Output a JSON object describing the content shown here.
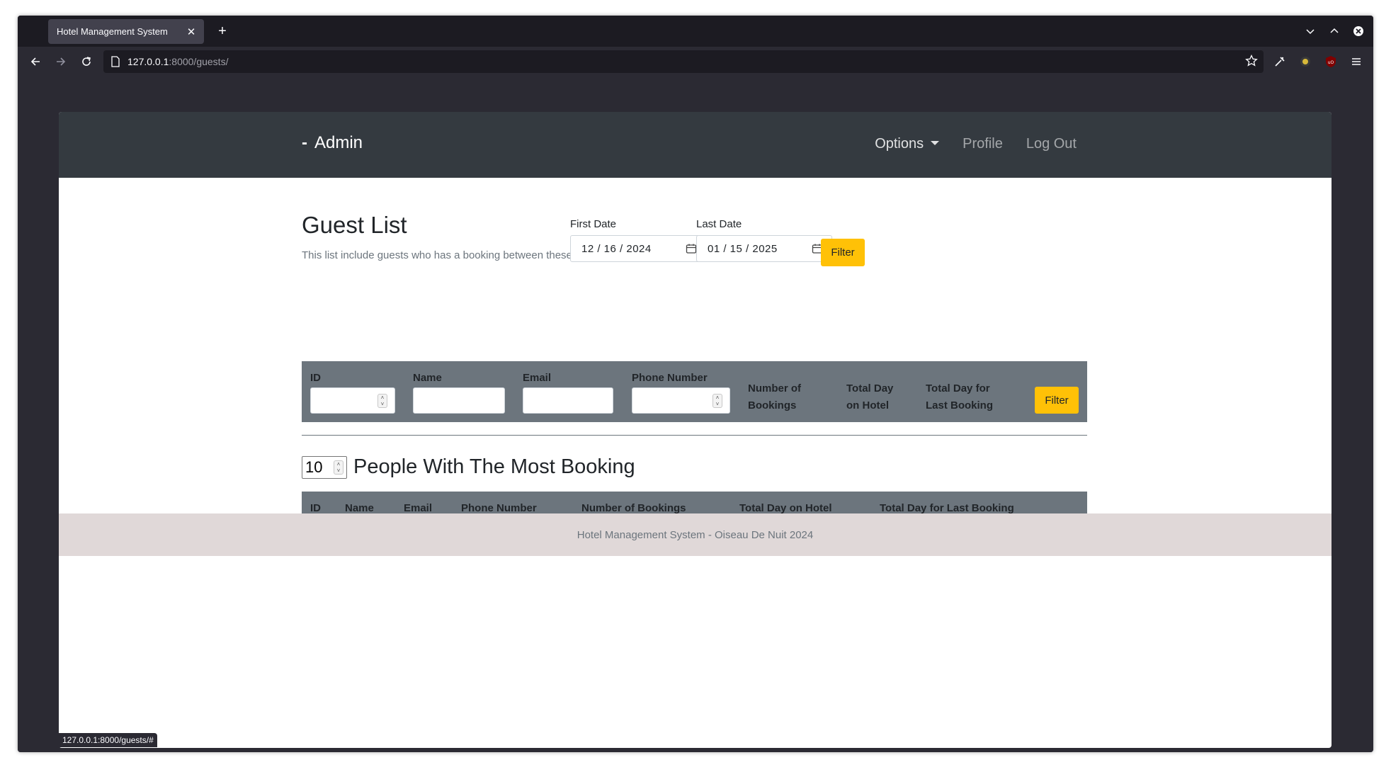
{
  "browser": {
    "tab_title": "Hotel Management System",
    "url_host": "127.0.0.1",
    "url_path": ":8000/guests/",
    "status_url": "127.0.0.1:8000/guests/#"
  },
  "header": {
    "brand_dash": "-",
    "brand": "Admin",
    "nav": {
      "options": "Options",
      "profile": "Profile",
      "logout": "Log Out"
    }
  },
  "guest_list": {
    "title": "Guest List",
    "subtitle": "This list include guests who has a booking between these days",
    "first_date_label": "First Date",
    "first_date_value": "12 / 16 / 2024",
    "last_date_label": "Last Date",
    "last_date_value": "01 / 15 / 2025",
    "filter_label": "Filter"
  },
  "filter_table": {
    "id": "ID",
    "name": "Name",
    "email": "Email",
    "phone": "Phone Number",
    "bookings_l1": "Number of",
    "bookings_l2": "Bookings",
    "total_day_l1": "Total Day",
    "total_day_l2": "on Hotel",
    "last_booking_l1": "Total Day for",
    "last_booking_l2": "Last Booking",
    "filter_label": "Filter"
  },
  "most_booking": {
    "count": "10",
    "title": "People With The Most Booking",
    "columns": [
      "ID",
      "Name",
      "Email",
      "Phone Number",
      "Number of Bookings",
      "Total Day on Hotel",
      "Total Day for Last Booking"
    ]
  },
  "footer": {
    "text": "Hotel Management System - Oiseau De Nuit 2024"
  },
  "colors": {
    "navbar": "#343a40",
    "table_header": "#6c757d",
    "button": "#ffc107",
    "footer": "#e0d8d8"
  }
}
